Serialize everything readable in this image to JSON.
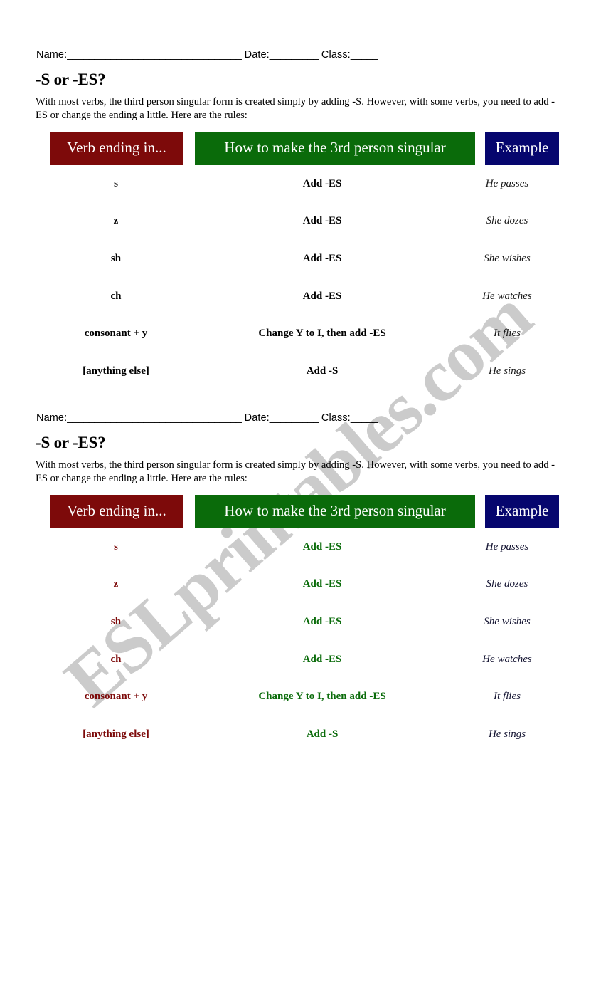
{
  "document": {
    "title": "-S or -ES?",
    "watermark": "ESLprintables.com"
  },
  "name_line": {
    "name_label": "Name:",
    "name_blank": "________________________________",
    "date_label": "Date:",
    "date_blank": "_________",
    "class_label": "Class:",
    "class_blank": "_____"
  },
  "intro": "With most verbs, the third person singular form is created simply by adding -S. However, with some verbs, you need to add -ES or change the ending a little. Here are the rules:",
  "table": {
    "headers": {
      "col1": "Verb ending in...",
      "col2": "How to make the 3rd person singular",
      "col3": "Example"
    },
    "header_colors": {
      "col1": "#7d0a0a",
      "col2": "#0a6b0a",
      "col3": "#06066e"
    },
    "rows": [
      {
        "ending": "s",
        "rule": "Add -ES",
        "example": "He passes"
      },
      {
        "ending": "z",
        "rule": "Add -ES",
        "example": "She dozes"
      },
      {
        "ending": "sh",
        "rule": "Add -ES",
        "example": "She wishes"
      },
      {
        "ending": "ch",
        "rule": "Add -ES",
        "example": "He watches"
      },
      {
        "ending": "consonant + y",
        "rule": "Change Y to I, then add -ES",
        "example": "It flies"
      },
      {
        "ending": "[anything else]",
        "rule": "Add -S",
        "example": "He sings"
      }
    ]
  },
  "copies": [
    {
      "id": "copy-1",
      "body_text_color_col1": "#000000",
      "body_text_color_col2": "#000000",
      "body_text_color_col3": "#1a1a1a"
    },
    {
      "id": "copy-2",
      "body_text_color_col1": "#7d0a0a",
      "body_text_color_col2": "#0a6b0a",
      "body_text_color_col3": "#141432"
    }
  ]
}
